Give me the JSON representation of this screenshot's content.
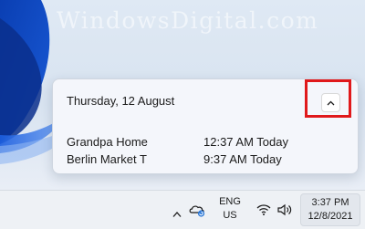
{
  "watermark": {
    "text": "WindowsDigital.com"
  },
  "calendar_panel": {
    "date_label": "Thursday, 12 August",
    "collapse_icon": "chevron-up-icon",
    "events": [
      {
        "title": "Grandpa Home",
        "time": "12:37 AM Today"
      },
      {
        "title": "Berlin Market T",
        "time": "9:37 AM Today"
      }
    ]
  },
  "taskbar": {
    "tray_icons": [
      "chevron-up-icon",
      "onedrive-icon",
      "wifi-icon",
      "speaker-icon"
    ],
    "language": {
      "line1": "ENG",
      "line2": "US"
    },
    "clock": {
      "time": "3:37 PM",
      "date": "12/8/2021"
    }
  },
  "colors": {
    "highlight": "#e0191b",
    "panel_bg": "#f4f6fb",
    "taskbar_bg": "#eef1f5"
  }
}
